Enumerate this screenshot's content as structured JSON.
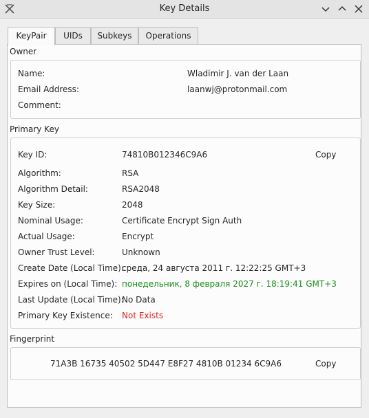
{
  "window": {
    "title": "Key Details"
  },
  "tabs": [
    {
      "label": "KeyPair"
    },
    {
      "label": "UIDs"
    },
    {
      "label": "Subkeys"
    },
    {
      "label": "Operations"
    }
  ],
  "owner": {
    "title": "Owner",
    "rows": [
      {
        "label": "Name:",
        "value": "Wladimir J. van der Laan"
      },
      {
        "label": "Email Address:",
        "value": "laanwj@protonmail.com"
      },
      {
        "label": "Comment:",
        "value": ""
      }
    ]
  },
  "primary_key": {
    "title": "Primary Key",
    "copy_label": "Copy",
    "rows": [
      {
        "label": "Key ID:",
        "value": "74810B012346C9A6"
      },
      {
        "label": "Algorithm:",
        "value": "RSA"
      },
      {
        "label": "Algorithm Detail:",
        "value": "RSA2048"
      },
      {
        "label": "Key Size:",
        "value": "2048"
      },
      {
        "label": "Nominal Usage:",
        "value": "Certificate Encrypt Sign Auth"
      },
      {
        "label": "Actual Usage:",
        "value": "Encrypt"
      },
      {
        "label": "Owner Trust Level:",
        "value": "Unknown"
      },
      {
        "label": "Create Date (Local Time):",
        "value": "среда, 24 августа 2011 г. 12:22:25 GMT+3"
      },
      {
        "label": "Expires on (Local Time):",
        "value": "понедельник, 8 февраля 2027 г. 18:19:41 GMT+3"
      },
      {
        "label": "Last Update (Local Time):",
        "value": "No Data"
      },
      {
        "label": "Primary Key Existence:",
        "value": "Not Exists"
      }
    ]
  },
  "fingerprint": {
    "title": "Fingerprint",
    "value": "71A3B 16735 40502 5D447 E8F27 4810B 01234 6C9A6",
    "copy_label": "Copy"
  },
  "colors": {
    "expires": "#1a8c1a",
    "not_exists": "#da1f1f"
  },
  "icons": [
    "app-icon",
    "minimize-icon",
    "maximize-icon",
    "close-icon"
  ]
}
